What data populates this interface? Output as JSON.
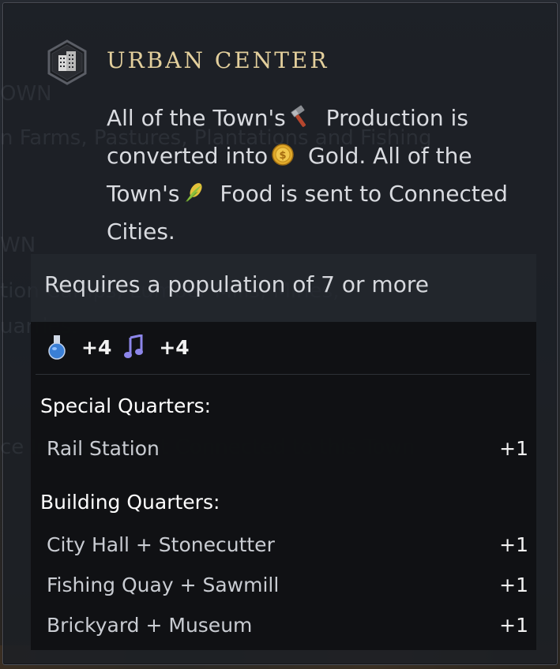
{
  "tooltip": {
    "title": "URBAN CENTER",
    "header_icon": "building-icon",
    "description": {
      "part1": "All of the Town's",
      "production_icon": "hammer-icon",
      "part2": "Production is converted into",
      "gold_icon": "gold-coin-icon",
      "part3": "Gold. All of the Town's",
      "food_icon": "corn-icon",
      "part4": "Food is sent to Connected Cities."
    },
    "requirement": "Requires a population of 7 or more",
    "yields": [
      {
        "icon": "science-flask-icon",
        "value": "+4"
      },
      {
        "icon": "culture-note-icon",
        "value": "+4"
      }
    ],
    "special_quarters": {
      "title": "Special Quarters:",
      "rows": [
        {
          "label": "Rail Station",
          "value": "+1"
        }
      ]
    },
    "building_quarters": {
      "title": "Building Quarters:",
      "rows": [
        {
          "label": "City Hall + Stonecutter",
          "value": "+1"
        },
        {
          "label": "Fishing Quay + Sawmill",
          "value": "+1"
        },
        {
          "label": "Brickyard + Museum",
          "value": "+1"
        }
      ]
    }
  }
}
